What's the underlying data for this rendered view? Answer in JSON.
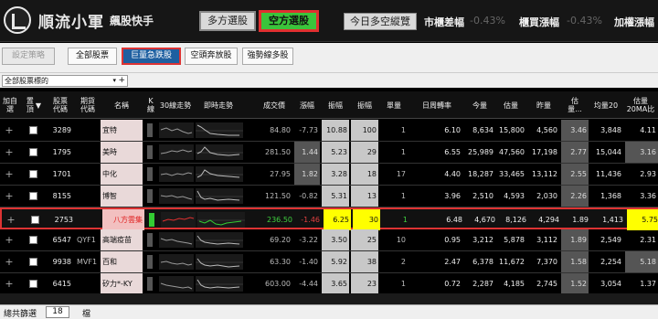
{
  "header": {
    "app_title": "順流小軍",
    "app_subtitle": "飆股快手",
    "mode_bear": "多方選股",
    "mode_bull": "空方選股",
    "today_btn": "今日多空縱覽",
    "market_label": "市櫃差幅",
    "market_value": "-0.43%",
    "otc_label": "櫃買漲幅",
    "otc_value": "-0.43%",
    "weighted_label": "加權漲幅"
  },
  "toolbar": {
    "settings": "設定策略",
    "tabs": [
      "全部股票",
      "巨量急跌股",
      "空頭奔放股",
      "強勢線多股"
    ]
  },
  "selector": {
    "value": "全部股票標的",
    "arrow": "▾",
    "plus": "+"
  },
  "columns": {
    "add": "加自\n選",
    "pin": "置\n頂",
    "code": "股票\n代碼",
    "fut": "期貨\n代碼",
    "name": "名稱",
    "k": "K\n線",
    "trend30": "30線走勢",
    "intraday": "即時走勢",
    "price": "成交價",
    "chg": "漲幅",
    "amp": "振幅",
    "amp2": "振幅",
    "vol": "單量",
    "turnover": "日周轉率",
    "today": "今量",
    "est": "估量",
    "yest": "昨量",
    "estratio": "估\n量...",
    "avg20": "均量20",
    "est20": "估量\n20MA比"
  },
  "rows": [
    {
      "code": "3289",
      "fut": "",
      "name": "宜特",
      "price": "84.80",
      "chg": "-7.73",
      "amp": "10.88",
      "amp2": "100",
      "vol": "1",
      "turnover": "6.10",
      "today": "8,634",
      "est": "15,800",
      "yest": "4,560",
      "ratio": "3.46",
      "avg20": "3,848",
      "est20": "4.11"
    },
    {
      "code": "1795",
      "fut": "",
      "name": "美時",
      "price": "281.50",
      "chg": "1.44",
      "amp": "5.23",
      "amp2": "29",
      "vol": "1",
      "turnover": "6.55",
      "today": "25,989",
      "est": "47,560",
      "yest": "17,198",
      "ratio": "2.77",
      "avg20": "15,044",
      "est20": "3.16"
    },
    {
      "code": "1701",
      "fut": "",
      "name": "中化",
      "price": "27.95",
      "chg": "1.82",
      "amp": "3.28",
      "amp2": "18",
      "vol": "17",
      "turnover": "4.40",
      "today": "18,287",
      "est": "33,465",
      "yest": "13,112",
      "ratio": "2.55",
      "avg20": "11,436",
      "est20": "2.93"
    },
    {
      "code": "8155",
      "fut": "",
      "name": "博智",
      "price": "121.50",
      "chg": "-0.82",
      "amp": "5.31",
      "amp2": "13",
      "vol": "1",
      "turnover": "3.96",
      "today": "2,510",
      "est": "4,593",
      "yest": "2,030",
      "ratio": "2.26",
      "avg20": "1,368",
      "est20": "3.36"
    },
    {
      "code": "2753",
      "fut": "",
      "name": "八方雲集",
      "price": "236.50",
      "chg": "-1.46",
      "amp": "6.25",
      "amp2": "30",
      "vol": "1",
      "turnover": "6.48",
      "today": "4,670",
      "est": "8,126",
      "yest": "4,294",
      "ratio": "1.89",
      "avg20": "1,413",
      "est20": "5.75"
    },
    {
      "code": "6547",
      "fut": "QYF1",
      "name": "高端疫苗",
      "price": "69.20",
      "chg": "-3.22",
      "amp": "3.50",
      "amp2": "25",
      "vol": "10",
      "turnover": "0.95",
      "today": "3,212",
      "est": "5,878",
      "yest": "3,112",
      "ratio": "1.89",
      "avg20": "2,549",
      "est20": "2.31"
    },
    {
      "code": "9938",
      "fut": "MVF1",
      "name": "百和",
      "price": "63.30",
      "chg": "-1.40",
      "amp": "5.92",
      "amp2": "38",
      "vol": "2",
      "turnover": "2.47",
      "today": "6,378",
      "est": "11,672",
      "yest": "7,370",
      "ratio": "1.58",
      "avg20": "2,254",
      "est20": "5.18"
    },
    {
      "code": "6415",
      "fut": "",
      "name": "矽力*-KY",
      "price": "603.00",
      "chg": "-4.44",
      "amp": "3.65",
      "amp2": "23",
      "vol": "1",
      "turnover": "0.72",
      "today": "2,287",
      "est": "4,185",
      "yest": "2,745",
      "ratio": "1.52",
      "avg20": "3,054",
      "est20": "1.37"
    }
  ],
  "status": {
    "label": "總共篩選",
    "count": "18",
    "unit": "檔"
  },
  "colors": {
    "highlight_border": "#dd3333",
    "bull_button": "#3bc43b",
    "active_tab": "#1e5fa0",
    "yellow": "#ffff00"
  }
}
